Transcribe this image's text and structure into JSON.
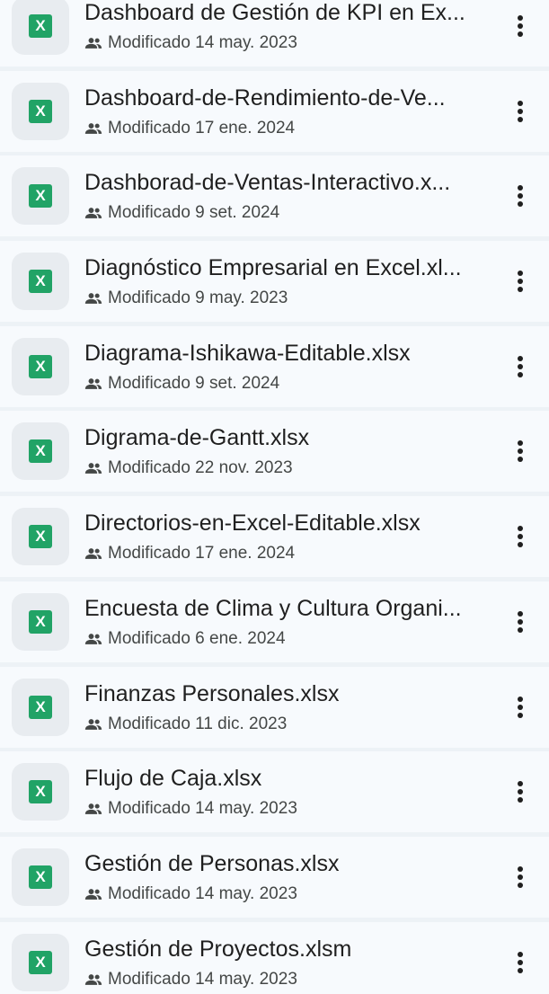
{
  "files": [
    {
      "name": "Dashboard de Gestión de KPI en Ex...",
      "modified": "Modificado 14 may. 2023",
      "icon": "excel-file-icon"
    },
    {
      "name": "Dashboard-de-Rendimiento-de-Ve...",
      "modified": "Modificado 17 ene. 2024",
      "icon": "excel-file-icon"
    },
    {
      "name": "Dashborad-de-Ventas-Interactivo.x...",
      "modified": "Modificado 9 set. 2024",
      "icon": "excel-file-icon"
    },
    {
      "name": "Diagnóstico Empresarial en Excel.xl...",
      "modified": "Modificado 9 may. 2023",
      "icon": "excel-file-icon"
    },
    {
      "name": "Diagrama-Ishikawa-Editable.xlsx",
      "modified": "Modificado 9 set. 2024",
      "icon": "excel-file-icon"
    },
    {
      "name": "Digrama-de-Gantt.xlsx",
      "modified": "Modificado 22 nov. 2023",
      "icon": "excel-file-icon"
    },
    {
      "name": "Directorios-en-Excel-Editable.xlsx",
      "modified": "Modificado 17 ene. 2024",
      "icon": "excel-file-icon"
    },
    {
      "name": "Encuesta de Clima y Cultura Organi...",
      "modified": "Modificado 6 ene. 2024",
      "icon": "excel-file-icon"
    },
    {
      "name": "Finanzas Personales.xlsx",
      "modified": "Modificado 11 dic. 2023",
      "icon": "excel-file-icon"
    },
    {
      "name": "Flujo de Caja.xlsx",
      "modified": "Modificado 14 may. 2023",
      "icon": "excel-file-icon"
    },
    {
      "name": "Gestión de Personas.xlsx",
      "modified": "Modificado 14 may. 2023",
      "icon": "excel-file-icon"
    },
    {
      "name": "Gestión de Proyectos.xlsm",
      "modified": "Modificado 14 may. 2023",
      "icon": "excel-file-icon"
    }
  ],
  "excel_badge": "X",
  "shared_icon": "people-icon",
  "more_icon": "more-vert-icon",
  "colors": {
    "excel_green": "#21a366",
    "row_bg": "#f7fafd",
    "separator": "#edf2f6"
  }
}
